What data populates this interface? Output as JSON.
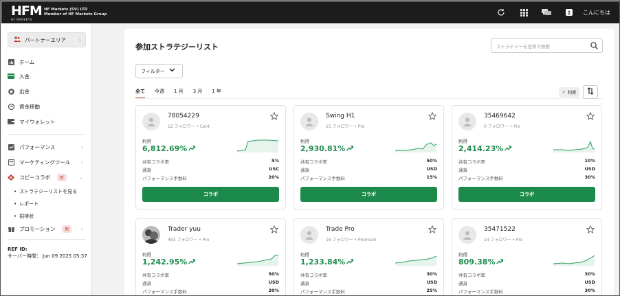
{
  "topbar": {
    "logo_text": "HFM",
    "logo_sub": "HF MARKETS",
    "company_line1": "HF Markets (SV) LTD",
    "company_line2": "Member of HF Markets Group",
    "greeting": "こんにちは",
    "icons": [
      "refresh-icon",
      "apps-grid-icon",
      "chat-icon",
      "account-icon"
    ]
  },
  "sidebar": {
    "partner_area": "パートナーエリア",
    "items": [
      {
        "label": "ホーム",
        "icon": "chart-icon"
      },
      {
        "label": "入金",
        "icon": "deposit-icon"
      },
      {
        "label": "出金",
        "icon": "withdraw-icon"
      },
      {
        "label": "資金移動",
        "icon": "transfer-icon"
      },
      {
        "label": "マイウォレット",
        "icon": "wallet-icon"
      },
      {
        "label": "パフォーマンス",
        "icon": "performance-icon"
      },
      {
        "label": "マーケティングツール",
        "icon": "marketing-icon"
      },
      {
        "label": "コピーコラボ",
        "icon": "copy-icon",
        "badge": "新"
      },
      {
        "label": "プロモーション",
        "icon": "gift-icon",
        "badge": "新"
      }
    ],
    "copy_sub": [
      "ストラテジーリストを見る",
      "レポート",
      "招待状"
    ],
    "ref_label": "REF ID:",
    "server_time": "サーバー時間： Jun 09 2025 05:37"
  },
  "main": {
    "title": "参加ストラテジーリスト",
    "search_placeholder": "ストラテジーを名称で検索",
    "filter_label": "フィルター",
    "tabs": [
      "全て",
      "今週",
      "1 月",
      "3 月",
      "1 年"
    ],
    "profit_chip": "利得",
    "profit_label": "利得",
    "collab_label": "コラボ",
    "stat_labels": [
      "共有コラボ率",
      "通貨",
      "パフォーマンス手数料"
    ]
  },
  "accent": "#1c8a4a",
  "strategies": [
    {
      "name": "78054229",
      "follow": "12 フォロワー",
      "type": "Cent",
      "profit": "6,812.69%",
      "share": "5%",
      "currency": "USC",
      "fee": "20%",
      "avatar": "default"
    },
    {
      "name": "Swing H1",
      "follow": "15 フォロワー",
      "type": "Pro",
      "profit": "2,930.81%",
      "share": "50%",
      "currency": "USD",
      "fee": "15%",
      "avatar": "default"
    },
    {
      "name": "35469642",
      "follow": "0 フォロワー",
      "type": "Pro",
      "profit": "2,414.23%",
      "share": "10%",
      "currency": "USD",
      "fee": "30%",
      "avatar": "default"
    },
    {
      "name": "Trader yuu",
      "follow": "463 フォロワー",
      "type": "Pro",
      "profit": "1,242.95%",
      "share": "50%",
      "currency": "USD",
      "fee": "20%",
      "avatar": "photo"
    },
    {
      "name": "Trade Pro",
      "follow": "16 フォロワー",
      "type": "Premium",
      "profit": "1,233.84%",
      "share": "30%",
      "currency": "USD",
      "fee": "25%",
      "avatar": "default"
    },
    {
      "name": "35471522",
      "follow": "14 フォロワー",
      "type": "Pro",
      "profit": "809.38%",
      "share": "30%",
      "currency": "USD",
      "fee": "30%",
      "avatar": "default"
    }
  ]
}
